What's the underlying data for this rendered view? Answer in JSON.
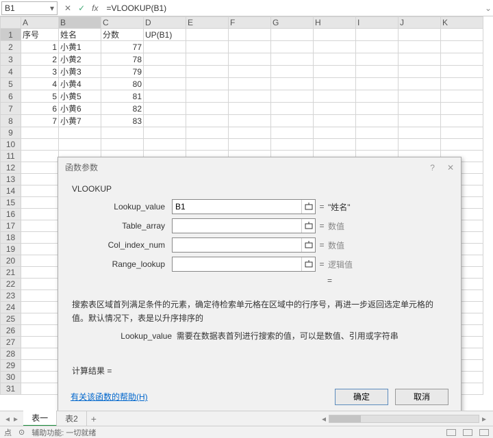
{
  "formulaBar": {
    "nameBox": "B1",
    "formula": "=VLOOKUP(B1)"
  },
  "columns": [
    "A",
    "B",
    "C",
    "D",
    "E",
    "F",
    "G",
    "H",
    "I",
    "J",
    "K"
  ],
  "rows": [
    1,
    2,
    3,
    4,
    5,
    6,
    7,
    8,
    9,
    10,
    11,
    12,
    13,
    14,
    15,
    16,
    17,
    18,
    19,
    20,
    21,
    22,
    23,
    24,
    25,
    26,
    27,
    28,
    29,
    30,
    31
  ],
  "cells": {
    "header": {
      "A": "序号",
      "B": "姓名",
      "C": "分数",
      "D": "UP(B1)"
    },
    "data": [
      {
        "A": "1",
        "B": "小黄1",
        "C": "77"
      },
      {
        "A": "2",
        "B": "小黄2",
        "C": "78"
      },
      {
        "A": "3",
        "B": "小黄3",
        "C": "79"
      },
      {
        "A": "4",
        "B": "小黄4",
        "C": "80"
      },
      {
        "A": "5",
        "B": "小黄5",
        "C": "81"
      },
      {
        "A": "6",
        "B": "小黄6",
        "C": "82"
      },
      {
        "A": "7",
        "B": "小黄7",
        "C": "83"
      }
    ]
  },
  "dialog": {
    "title": "函数参数",
    "fn": "VLOOKUP",
    "args": [
      {
        "label": "Lookup_value",
        "value": "B1",
        "result": "\"姓名\"",
        "resultClass": "q"
      },
      {
        "label": "Table_array",
        "value": "",
        "result": "数值",
        "resultClass": ""
      },
      {
        "label": "Col_index_num",
        "value": "",
        "result": "数值",
        "resultClass": ""
      },
      {
        "label": "Range_lookup",
        "value": "",
        "result": "逻辑值",
        "resultClass": ""
      }
    ],
    "eq": "=",
    "desc": "搜索表区域首列满足条件的元素，确定待检索单元格在区域中的行序号，再进一步返回选定单元格的值。默认情况下，表是以升序排序的",
    "desc2l": "Lookup_value",
    "desc2r": "需要在数据表首列进行搜索的值，可以是数值、引用或字符串",
    "calcRes": "计算结果 =",
    "helpLink": "有关该函数的帮助(H)",
    "ok": "确定",
    "cancel": "取消"
  },
  "tabs": {
    "items": [
      "表一",
      "表2"
    ],
    "active": 0,
    "plus": "+"
  },
  "status": {
    "left1": "点",
    "left2": "辅助功能: 一切就绪"
  }
}
